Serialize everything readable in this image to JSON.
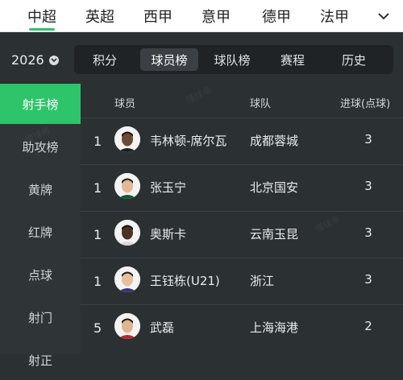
{
  "leagues": [
    "中超",
    "英超",
    "西甲",
    "意甲",
    "德甲",
    "法甲"
  ],
  "active_league": 0,
  "season": "2026",
  "subtabs": [
    "积分",
    "球员榜",
    "球队榜",
    "赛程",
    "历史"
  ],
  "active_subtab": 1,
  "sidebar": [
    "射手榜",
    "助攻榜",
    "黄牌",
    "红牌",
    "点球",
    "射门",
    "射正"
  ],
  "active_side": 0,
  "table": {
    "headers": {
      "player": "球员",
      "team": "球队",
      "goals": "进球(点球)"
    },
    "rows": [
      {
        "rank": "1",
        "name": "韦林顿-席尔瓦",
        "team": "成都蓉城",
        "goals": "3",
        "skin": "#6b4a35",
        "hair": "#1a1410",
        "shirt": "#1e1e1e"
      },
      {
        "rank": "1",
        "name": "张玉宁",
        "team": "北京国安",
        "goals": "3",
        "skin": "#e3b896",
        "hair": "#1e1a18",
        "shirt": "#0e5a2a"
      },
      {
        "rank": "1",
        "name": "奥斯卡",
        "team": "云南玉昆",
        "goals": "3",
        "skin": "#4a3326",
        "hair": "#151010",
        "shirt": "#d8d8d8"
      },
      {
        "rank": "1",
        "name": "王钰栋(U21)",
        "team": "浙江",
        "goals": "3",
        "skin": "#e8bf9c",
        "hair": "#1d1816",
        "shirt": "#3a2f7a"
      },
      {
        "rank": "5",
        "name": "武磊",
        "team": "上海海港",
        "goals": "2",
        "skin": "#e2b48f",
        "hair": "#1b1614",
        "shirt": "#b0282c"
      }
    ]
  }
}
